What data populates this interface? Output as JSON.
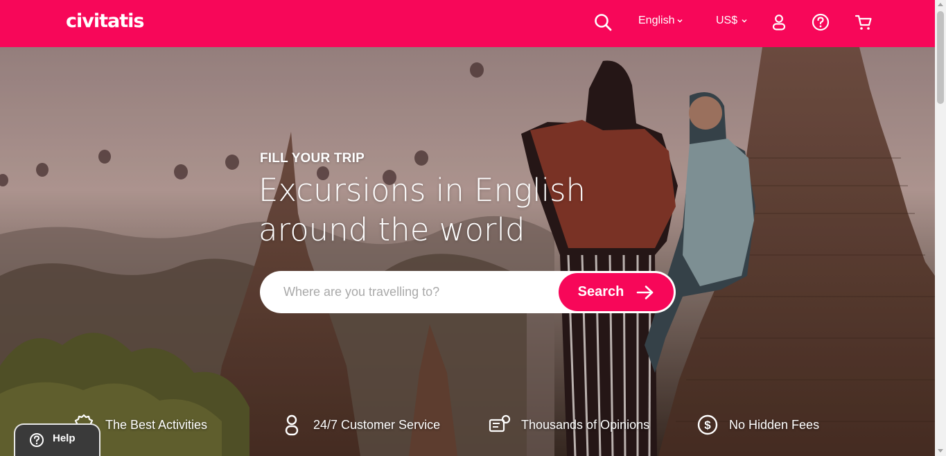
{
  "brand": {
    "logo_text": "civitatis",
    "color": "#f70759"
  },
  "nav": {
    "search_icon": "search-icon",
    "language": "English",
    "currency": "US$",
    "user_icon": "user-icon",
    "help_icon": "question-circle-icon",
    "cart_icon": "cart-icon"
  },
  "hero": {
    "eyebrow": "FILL YOUR TRIP",
    "headline_line1": "Excursions in English",
    "headline_line2": "around the world"
  },
  "search": {
    "placeholder": "Where are you travelling to?",
    "button_label": "Search"
  },
  "features": [
    {
      "icon": "award-badge-icon",
      "label": "The Best Activities"
    },
    {
      "icon": "support-person-icon",
      "label": "24/7 Customer Service"
    },
    {
      "icon": "reviews-icon",
      "label": "Thousands of Opinions"
    },
    {
      "icon": "dollar-circle-icon",
      "label": "No Hidden Fees"
    }
  ],
  "help_widget": {
    "label": "Help"
  }
}
